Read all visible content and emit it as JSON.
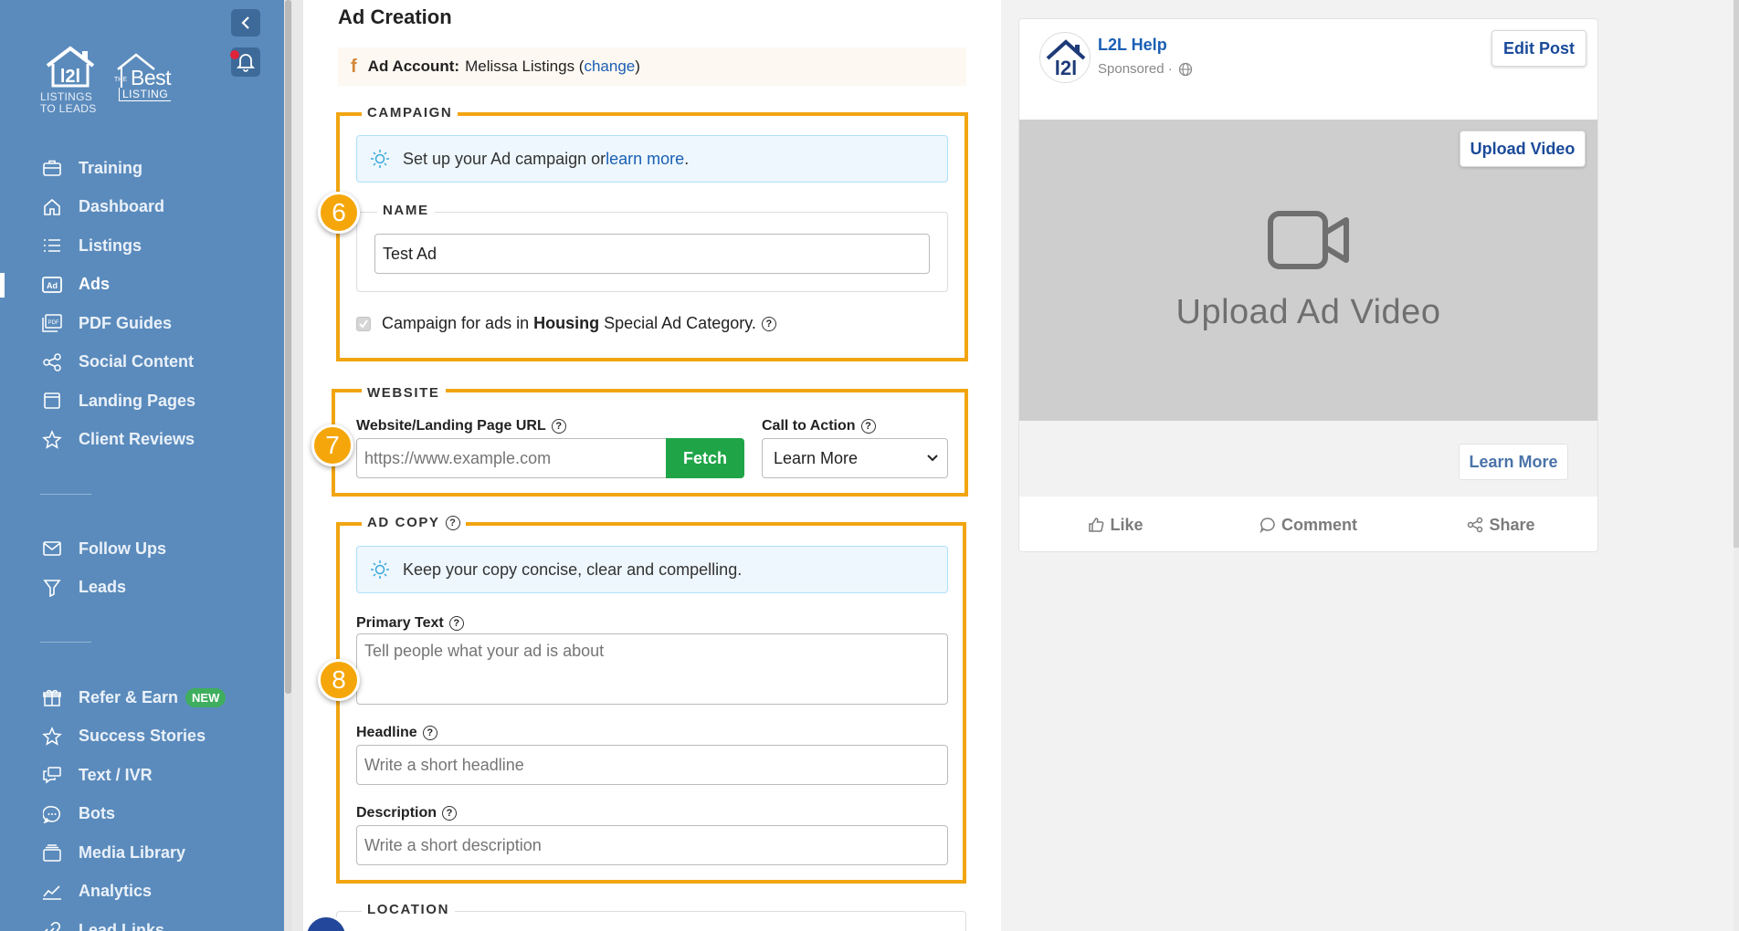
{
  "sidebar": {
    "logo_l2l_caption": [
      "LISTINGS",
      "TO LEADS"
    ],
    "logo_best": {
      "the": "THE",
      "best": "Best",
      "listing": "LISTING"
    },
    "nav_primary": [
      {
        "label": "Training",
        "icon": "briefcase-icon"
      },
      {
        "label": "Dashboard",
        "icon": "home-icon"
      },
      {
        "label": "Listings",
        "icon": "list-icon"
      },
      {
        "label": "Ads",
        "icon": "ad-icon",
        "active": true
      },
      {
        "label": "PDF Guides",
        "icon": "pdf-icon"
      },
      {
        "label": "Social Content",
        "icon": "share-icon"
      },
      {
        "label": "Landing Pages",
        "icon": "window-icon"
      },
      {
        "label": "Client Reviews",
        "icon": "star-icon"
      }
    ],
    "nav_secondary": [
      {
        "label": "Follow Ups",
        "icon": "mail-icon"
      },
      {
        "label": "Leads",
        "icon": "filter-icon"
      }
    ],
    "nav_tertiary": [
      {
        "label": "Refer & Earn",
        "icon": "gift-icon",
        "badge": "NEW"
      },
      {
        "label": "Success Stories",
        "icon": "star-icon"
      },
      {
        "label": "Text / IVR",
        "icon": "message-icon"
      },
      {
        "label": "Bots",
        "icon": "chat-icon"
      },
      {
        "label": "Media Library",
        "icon": "library-icon"
      },
      {
        "label": "Analytics",
        "icon": "chart-icon"
      },
      {
        "label": "Lead Links",
        "icon": "link-icon"
      }
    ]
  },
  "main": {
    "title": "Ad Creation",
    "ad_account": {
      "label": "Ad Account:",
      "value": "Melissa Listings (",
      "link": "change",
      "suffix": ")"
    },
    "campaign": {
      "legend": "CAMPAIGN",
      "tip_text": "Set up your Ad campaign or ",
      "tip_link": "learn more",
      "tip_suffix": ".",
      "name_legend": "NAME",
      "name_value": "Test Ad",
      "housing_pre": "Campaign for ads in ",
      "housing_bold": "Housing",
      "housing_post": " Special Ad Category."
    },
    "website": {
      "legend": "WEBSITE",
      "url_label": "Website/Landing Page URL",
      "url_placeholder": "https://www.example.com",
      "fetch_label": "Fetch",
      "cta_label": "Call to Action",
      "cta_value": "Learn More"
    },
    "ad_copy": {
      "legend": "AD COPY",
      "tip_text": "Keep your copy concise, clear and compelling.",
      "primary_label": "Primary Text",
      "primary_placeholder": "Tell people what your ad is about",
      "headline_label": "Headline",
      "headline_placeholder": "Write a short headline",
      "description_label": "Description",
      "description_placeholder": "Write a short description"
    },
    "location": {
      "legend": "LOCATION"
    },
    "steps": [
      "6",
      "7",
      "8"
    ]
  },
  "preview": {
    "page_name": "L2L Help",
    "sponsored": "Sponsored ·",
    "edit_post": "Edit Post",
    "upload_video": "Upload Video",
    "video_placeholder": "Upload Ad Video",
    "cta": "Learn More",
    "actions": [
      "Like",
      "Comment",
      "Share"
    ]
  },
  "colors": {
    "sidebar": "#5b8bbc",
    "highlight": "#f1a511",
    "fetch": "#1fa548",
    "link": "#1a5fb4"
  }
}
